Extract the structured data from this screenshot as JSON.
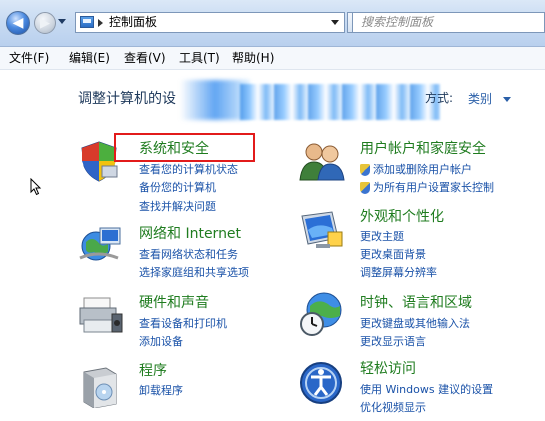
{
  "address_bar": {
    "path_label": "控制面板",
    "search_placeholder": "搜索控制面板"
  },
  "menu": {
    "items": [
      "文件(F)",
      "编辑(E)",
      "查看(V)",
      "工具(T)",
      "帮助(H)"
    ]
  },
  "header": {
    "title": "调整计算机的设",
    "view_by_label": "方式:",
    "view_by_value": "类别"
  },
  "categories": [
    {
      "title": "系统和安全",
      "links": [
        "查看您的计算机状态",
        "备份您的计算机",
        "查找并解决问题"
      ]
    },
    {
      "title": "网络和 Internet",
      "links": [
        "查看网络状态和任务",
        "选择家庭组和共享选项"
      ]
    },
    {
      "title": "硬件和声音",
      "links": [
        "查看设备和打印机",
        "添加设备"
      ]
    },
    {
      "title": "程序",
      "links": [
        "卸载程序"
      ]
    },
    {
      "title": "用户帐户和家庭安全",
      "links": [
        "添加或删除用户帐户",
        "为所有用户设置家长控制"
      ]
    },
    {
      "title": "外观和个性化",
      "links": [
        "更改主题",
        "更改桌面背景",
        "调整屏幕分辨率"
      ]
    },
    {
      "title": "时钟、语言和区域",
      "links": [
        "更改键盘或其他输入法",
        "更改显示语言"
      ]
    },
    {
      "title": "轻松访问",
      "links": [
        "使用 Windows 建议的设置",
        "优化视频显示"
      ]
    }
  ],
  "colors": {
    "category_title": "#1f7c1f",
    "link": "#1a52a8",
    "highlight_box": "#e21b1b"
  }
}
